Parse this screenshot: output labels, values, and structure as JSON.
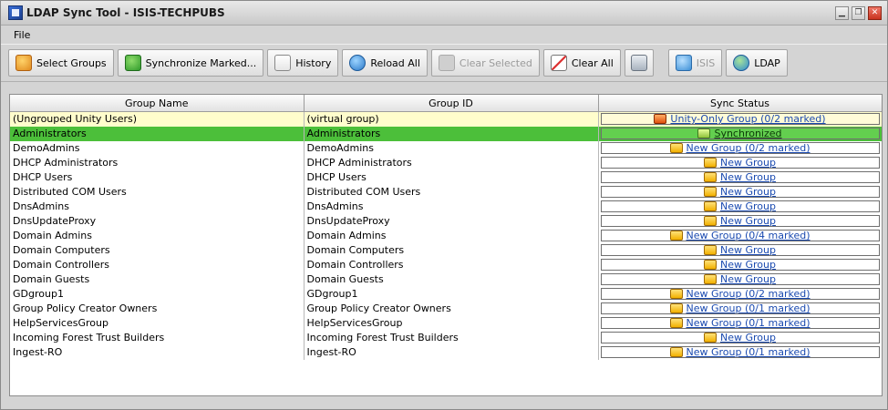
{
  "window": {
    "title": "LDAP Sync Tool - ISIS-TECHPUBS"
  },
  "menu": {
    "file": "File"
  },
  "toolbar": {
    "select_groups": "Select Groups",
    "synchronize_marked": "Synchronize Marked...",
    "history": "History",
    "reload_all": "Reload All",
    "clear_selected": "Clear Selected",
    "clear_all": "Clear All",
    "isis": "ISIS",
    "ldap": "LDAP"
  },
  "table": {
    "columns": [
      "Group Name",
      "Group ID",
      "Sync Status"
    ],
    "rows": [
      {
        "name": "(Ungrouped Unity Users)",
        "id": "(virtual group)",
        "status": "Unity-Only Group (0/2 marked)",
        "kind": "virtual"
      },
      {
        "name": "Administrators",
        "id": "Administrators",
        "status": "Synchronized",
        "kind": "selected"
      },
      {
        "name": "DemoAdmins",
        "id": "DemoAdmins",
        "status": "New Group (0/2 marked)",
        "kind": "normal"
      },
      {
        "name": "DHCP Administrators",
        "id": "DHCP Administrators",
        "status": "New Group",
        "kind": "normal"
      },
      {
        "name": "DHCP Users",
        "id": "DHCP Users",
        "status": "New Group",
        "kind": "normal"
      },
      {
        "name": "Distributed COM Users",
        "id": "Distributed COM Users",
        "status": "New Group",
        "kind": "normal"
      },
      {
        "name": "DnsAdmins",
        "id": "DnsAdmins",
        "status": "New Group",
        "kind": "normal"
      },
      {
        "name": "DnsUpdateProxy",
        "id": "DnsUpdateProxy",
        "status": "New Group",
        "kind": "normal"
      },
      {
        "name": "Domain Admins",
        "id": "Domain Admins",
        "status": "New Group (0/4 marked)",
        "kind": "normal"
      },
      {
        "name": "Domain Computers",
        "id": "Domain Computers",
        "status": "New Group",
        "kind": "normal"
      },
      {
        "name": "Domain Controllers",
        "id": "Domain Controllers",
        "status": "New Group",
        "kind": "normal"
      },
      {
        "name": "Domain Guests",
        "id": "Domain Guests",
        "status": "New Group",
        "kind": "normal"
      },
      {
        "name": "GDgroup1",
        "id": "GDgroup1",
        "status": "New Group (0/2 marked)",
        "kind": "normal"
      },
      {
        "name": "Group Policy Creator Owners",
        "id": "Group Policy Creator Owners",
        "status": "New Group (0/1 marked)",
        "kind": "normal"
      },
      {
        "name": "HelpServicesGroup",
        "id": "HelpServicesGroup",
        "status": "New Group (0/1 marked)",
        "kind": "normal"
      },
      {
        "name": "Incoming Forest Trust Builders",
        "id": "Incoming Forest Trust Builders",
        "status": "New Group",
        "kind": "normal"
      },
      {
        "name": "Ingest-RO",
        "id": "Ingest-RO",
        "status": "New Group (0/1 marked)",
        "kind": "normal"
      }
    ]
  }
}
